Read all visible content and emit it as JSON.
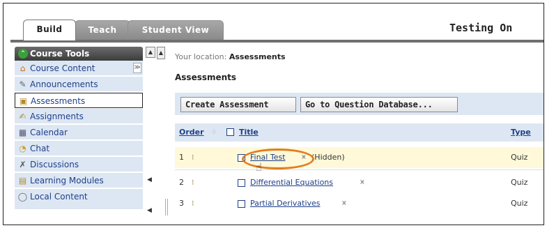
{
  "tabs": {
    "build": "Build",
    "teach": "Teach",
    "student_view": "Student View"
  },
  "header": {
    "title": "Testing On"
  },
  "nav": {
    "header_label": "Course Tools",
    "items": [
      {
        "label": "Course Content",
        "icon": "home-icon"
      },
      {
        "label": "Announcements",
        "icon": "megaphone-icon"
      },
      {
        "label": "Assessments",
        "icon": "assessment-icon"
      },
      {
        "label": "Assignments",
        "icon": "assignment-icon"
      },
      {
        "label": "Calendar",
        "icon": "calendar-icon"
      },
      {
        "label": "Chat",
        "icon": "chat-icon"
      },
      {
        "label": "Discussions",
        "icon": "discussion-icon"
      },
      {
        "label": "Learning Modules",
        "icon": "module-icon"
      },
      {
        "label": "Local Content",
        "icon": "content-icon"
      }
    ],
    "active_item": "Assessments"
  },
  "main": {
    "location_prefix": "Your location:",
    "location_value": "Assessments",
    "page_title": "Assessments",
    "buttons": {
      "create": "Create Assessment",
      "question_db": "Go to Question Database..."
    },
    "table": {
      "headers": {
        "order": "Order",
        "title": "Title",
        "type": "Type"
      },
      "rows": [
        {
          "num": "1",
          "title": "Final Test",
          "note": "(Hidden)",
          "type": "Quiz"
        },
        {
          "num": "2",
          "title": "Differential Equations",
          "note": "",
          "type": "Quiz"
        },
        {
          "num": "3",
          "title": "Partial Derivatives",
          "note": "",
          "type": "Quiz"
        }
      ]
    }
  },
  "colors": {
    "nav_bg": "#dde7f3",
    "link": "#1e3f8a",
    "highlight_ring": "#e27d1f",
    "selected_row": "#fff9d9"
  }
}
